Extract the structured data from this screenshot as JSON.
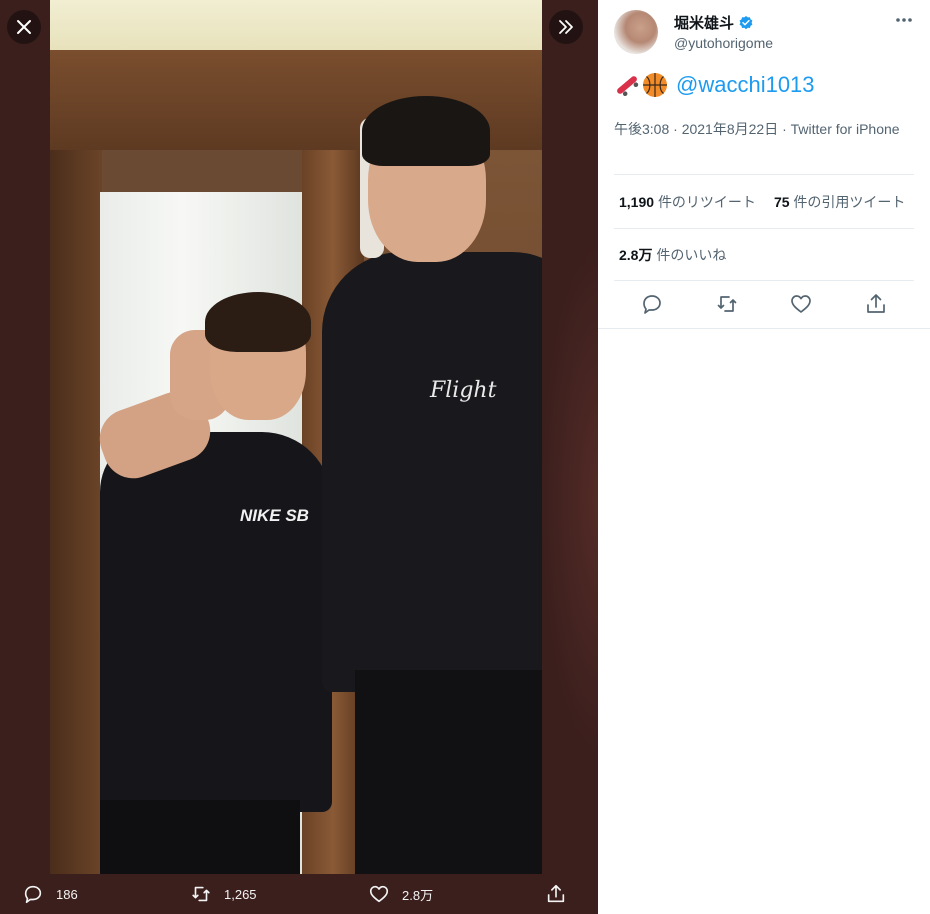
{
  "viewer": {
    "close_icon": "close-icon",
    "expand_icon": "chevron-double-right-icon",
    "shirt_logo_1": "NIKE SB",
    "shirt_logo_2": "Flight",
    "actions": [
      {
        "icon": "reply-icon",
        "count": "186"
      },
      {
        "icon": "retweet-icon",
        "count": "1,265"
      },
      {
        "icon": "like-icon",
        "count": "2.8万"
      },
      {
        "icon": "share-icon",
        "count": ""
      }
    ]
  },
  "tweet": {
    "display_name": "堀米雄斗",
    "handle": "@yutohorigome",
    "verified": true,
    "emojis": [
      "skateboard-emoji",
      "basketball-emoji"
    ],
    "mention": "@wacchi1013",
    "timestamp": "午後3:08 · 2021年8月22日 · Twitter for iPhone",
    "retweets_count": "1,190",
    "retweets_label": "件のリツイート",
    "quotes_count": "75",
    "quotes_label": "件の引用ツイート",
    "likes_count": "2.8万",
    "likes_label": "件のいいね"
  },
  "colors": {
    "accent": "#1d9bf0",
    "viewer_bg": "#3b1f1d",
    "text_primary": "#0f1419",
    "text_secondary": "#536471"
  }
}
